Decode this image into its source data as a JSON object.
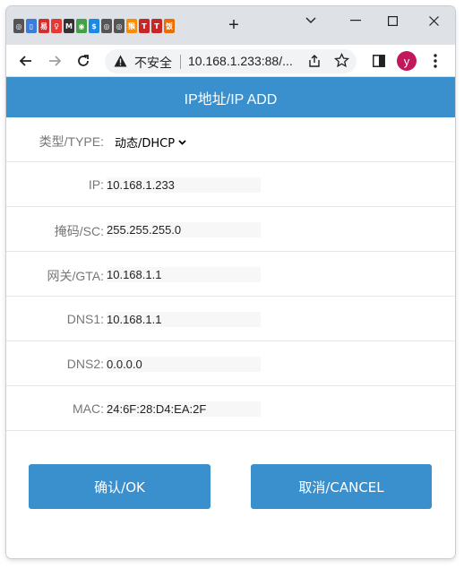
{
  "browser": {
    "tab_favicons": [
      {
        "name": "favicon-1",
        "color": "#555555",
        "glyph": "◎"
      },
      {
        "name": "favicon-2",
        "color": "#3b7dd8",
        "glyph": "▯"
      },
      {
        "name": "favicon-3",
        "color": "#d32f2f",
        "glyph": "易"
      },
      {
        "name": "favicon-4",
        "color": "#e53935",
        "glyph": "♀"
      },
      {
        "name": "favicon-5",
        "color": "#333333",
        "glyph": "M"
      },
      {
        "name": "favicon-6",
        "color": "#43a047",
        "glyph": "◉"
      },
      {
        "name": "favicon-7",
        "color": "#1e88e5",
        "glyph": "$"
      },
      {
        "name": "favicon-8",
        "color": "#555555",
        "glyph": "◎"
      },
      {
        "name": "favicon-9",
        "color": "#555555",
        "glyph": "◎"
      },
      {
        "name": "favicon-10",
        "color": "#fb8c00",
        "glyph": "猴"
      },
      {
        "name": "favicon-11",
        "color": "#c62828",
        "glyph": "T"
      },
      {
        "name": "favicon-12",
        "color": "#c62828",
        "glyph": "T"
      },
      {
        "name": "favicon-13",
        "color": "#ef6c00",
        "glyph": "饭"
      }
    ],
    "new_tab_label": "+",
    "security_label": "不安全",
    "url": "10.168.1.233:88/...",
    "profile_initial": "y",
    "profile_color": "#c2185b"
  },
  "page": {
    "title": "IP地址/IP ADD",
    "accent_color": "#3a8fcd",
    "type_field": {
      "label": "类型/TYPE:",
      "selected": "动态/DHCP"
    },
    "fields": [
      {
        "key": "ip",
        "label": "IP:",
        "value": "10.168.1.233"
      },
      {
        "key": "mask",
        "label": "掩码/SC:",
        "value": "255.255.255.0"
      },
      {
        "key": "gateway",
        "label": "网关/GTA:",
        "value": "10.168.1.1"
      },
      {
        "key": "dns1",
        "label": "DNS1:",
        "value": "10.168.1.1"
      },
      {
        "key": "dns2",
        "label": "DNS2:",
        "value": "0.0.0.0"
      },
      {
        "key": "mac",
        "label": "MAC:",
        "value": "24:6F:28:D4:EA:2F"
      }
    ],
    "ok_label": "确认/OK",
    "cancel_label": "取消/CANCEL"
  }
}
